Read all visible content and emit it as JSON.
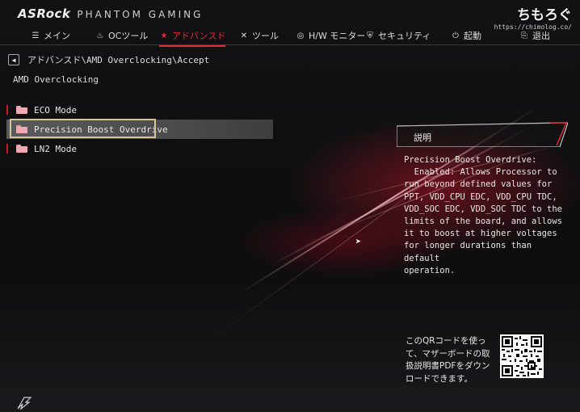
{
  "header": {
    "brand": "ASRock",
    "product_line": "PHANTOM GAMING",
    "watermark": "ちもろぐ",
    "watermark_url": "https://chimolog.co/"
  },
  "nav": {
    "items": [
      {
        "label": "メイン",
        "icon": "list-icon"
      },
      {
        "label": "OCツール",
        "icon": "flame-icon"
      },
      {
        "label": "アドバンスド",
        "icon": "star-icon",
        "active": true
      },
      {
        "label": "ツール",
        "icon": "tools-icon"
      },
      {
        "label": "H/W モニター",
        "icon": "monitor-gauge-icon"
      },
      {
        "label": "セキュリティ",
        "icon": "shield-icon"
      },
      {
        "label": "起動",
        "icon": "power-icon"
      },
      {
        "label": "退出",
        "icon": "exit-icon"
      }
    ]
  },
  "breadcrumb": {
    "path": "アドバンスド\\AMD Overclocking\\Accept"
  },
  "page_title": "AMD Overclocking",
  "menu": {
    "items": [
      {
        "label": "ECO Mode"
      },
      {
        "label": "Precision Boost Overdrive",
        "selected": true
      },
      {
        "label": "LN2 Mode"
      }
    ]
  },
  "help": {
    "title": "説明",
    "text": "Precision Boost Overdrive:\n  Enabled: Allows Processor to\nrun beyond defined values for\nPPT, VDD_CPU EDC, VDD_CPU TDC,\nVDD_SOC EDC, VDD_SOC TDC to the\nlimits of the board, and allows\nit to boost at higher voltages\nfor longer durations than default\noperation."
  },
  "qr": {
    "note": "このQRコードを使って、マザーボードの取扱説明書PDFをダウンロードできます。"
  },
  "colors": {
    "accent": "#e02a38",
    "selection_border": "#d8c596",
    "folder": "#f2a8b3"
  }
}
